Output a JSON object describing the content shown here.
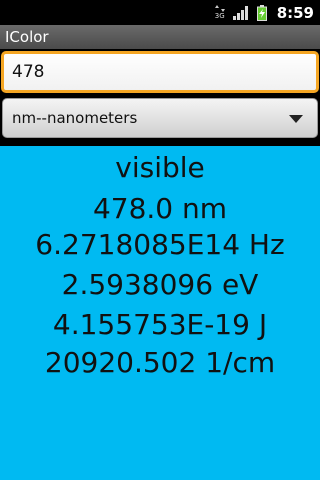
{
  "status_bar": {
    "network_top": "3G",
    "network_bottom": "3G",
    "time": "8:59",
    "battery_color": "#66cc33"
  },
  "app": {
    "title": "IColor"
  },
  "input": {
    "value": "478"
  },
  "unit_spinner": {
    "selected": "nm--nanometers"
  },
  "results": {
    "lines": [
      "visible",
      "478.0 nm",
      "6.2718085E14 Hz",
      "2.5938096 eV",
      "4.155753E-19 J",
      "20920.502 1/cm"
    ],
    "background_color": "#00baf2"
  },
  "colors": {
    "input_focus_border": "#f5a623",
    "title_bar": "#555555"
  }
}
